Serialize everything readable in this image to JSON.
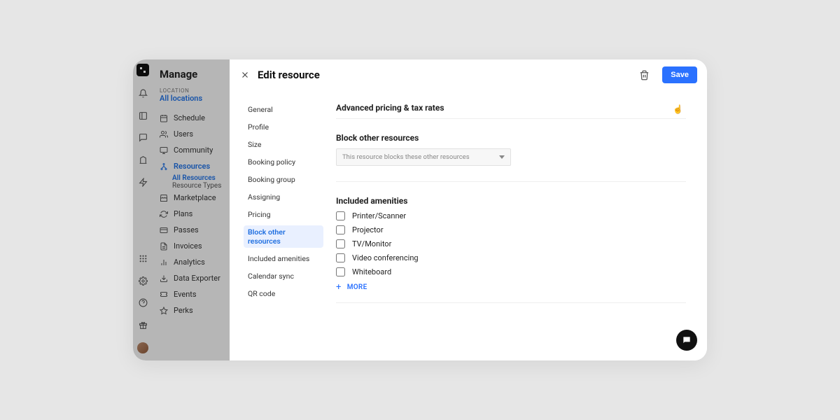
{
  "sidebar": {
    "app_title": "Manage",
    "location_label": "LOCATION",
    "location_value": "All locations",
    "items": [
      {
        "icon": "calendar",
        "label": "Schedule"
      },
      {
        "icon": "users",
        "label": "Users"
      },
      {
        "icon": "chat",
        "label": "Community"
      },
      {
        "icon": "resources",
        "label": "Resources",
        "active": true
      },
      {
        "icon": "store",
        "label": "Marketplace"
      },
      {
        "icon": "refresh",
        "label": "Plans"
      },
      {
        "icon": "card",
        "label": "Passes"
      },
      {
        "icon": "invoice",
        "label": "Invoices"
      },
      {
        "icon": "chart",
        "label": "Analytics"
      },
      {
        "icon": "export",
        "label": "Data Exporter"
      },
      {
        "icon": "ticket",
        "label": "Events"
      },
      {
        "icon": "star",
        "label": "Perks"
      }
    ],
    "resource_sub": [
      {
        "label": "All Resources",
        "active": true
      },
      {
        "label": "Resource Types"
      }
    ]
  },
  "modal": {
    "title": "Edit resource",
    "save_label": "Save",
    "sections": [
      "General",
      "Profile",
      "Size",
      "Booking policy",
      "Booking group",
      "Assigning",
      "Pricing",
      "Block other resources",
      "Included amenities",
      "Calendar sync",
      "QR code"
    ],
    "active_section": "Block other resources",
    "advanced_title": "Advanced pricing & tax rates",
    "block_title": "Block other resources",
    "block_select_placeholder": "This resource blocks these other resources",
    "amenities_title": "Included amenities",
    "amenities": [
      "Printer/Scanner",
      "Projector",
      "TV/Monitor",
      "Video conferencing",
      "Whiteboard"
    ],
    "more_label": "MORE"
  }
}
